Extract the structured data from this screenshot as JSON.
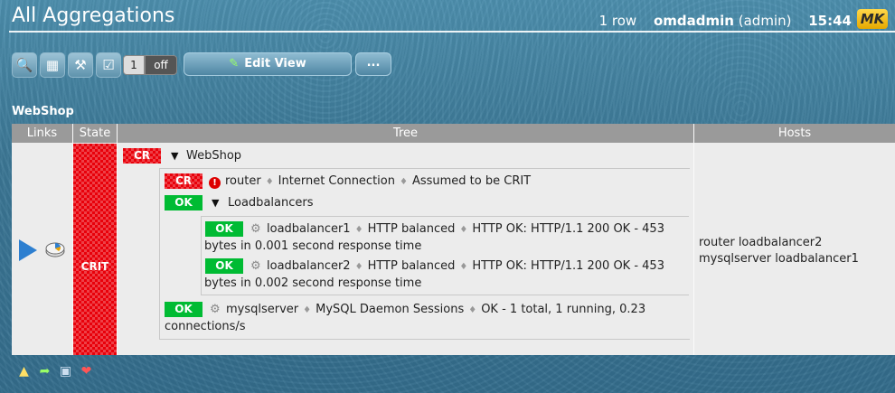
{
  "header": {
    "title": "All Aggregations",
    "row_count": "1 row",
    "user": "omdadmin",
    "role": "(admin)",
    "time": "15:44",
    "logo_text": "MK"
  },
  "toolbar": {
    "icons": [
      "search-icon",
      "display-options-icon",
      "hammer-icon",
      "checkbox-icon"
    ],
    "toggle_value": "1",
    "toggle_state": "off",
    "edit_view_label": "Edit View",
    "more_label": "..."
  },
  "group": {
    "title": "WebShop"
  },
  "table": {
    "headers": [
      "Links",
      "State",
      "Tree",
      "Hosts"
    ],
    "state": "CRIT",
    "tree": {
      "root": {
        "badge": "CR",
        "name": "WebShop"
      },
      "router": {
        "badge": "CR",
        "host": "router",
        "service": "Internet Connection",
        "output": "Assumed to be CRIT"
      },
      "lb_group": {
        "badge": "OK",
        "name": "Loadbalancers"
      },
      "lb1": {
        "badge": "OK",
        "host": "loadbalancer1",
        "service": "HTTP balanced",
        "output_line1": "HTTP OK: HTTP/1.1 200 OK - 453",
        "output_line2": "bytes in 0.001 second response time"
      },
      "lb2": {
        "badge": "OK",
        "host": "loadbalancer2",
        "service": "HTTP balanced",
        "output_line1": "HTTP OK: HTTP/1.1 200 OK - 453",
        "output_line2": "bytes in 0.002 second response time"
      },
      "mysql": {
        "badge": "OK",
        "host": "mysqlserver",
        "service": "MySQL Daemon Sessions",
        "output_line1": "OK - 1 total, 1 running, 0.23",
        "output_line2": "connections/s"
      }
    },
    "hosts_line1": "router loadbalancer2",
    "hosts_line2": "mysqlserver loadbalancer1"
  },
  "colors": {
    "crit": "#e8000a",
    "ok": "#00bb33",
    "background": "#3c7896"
  }
}
